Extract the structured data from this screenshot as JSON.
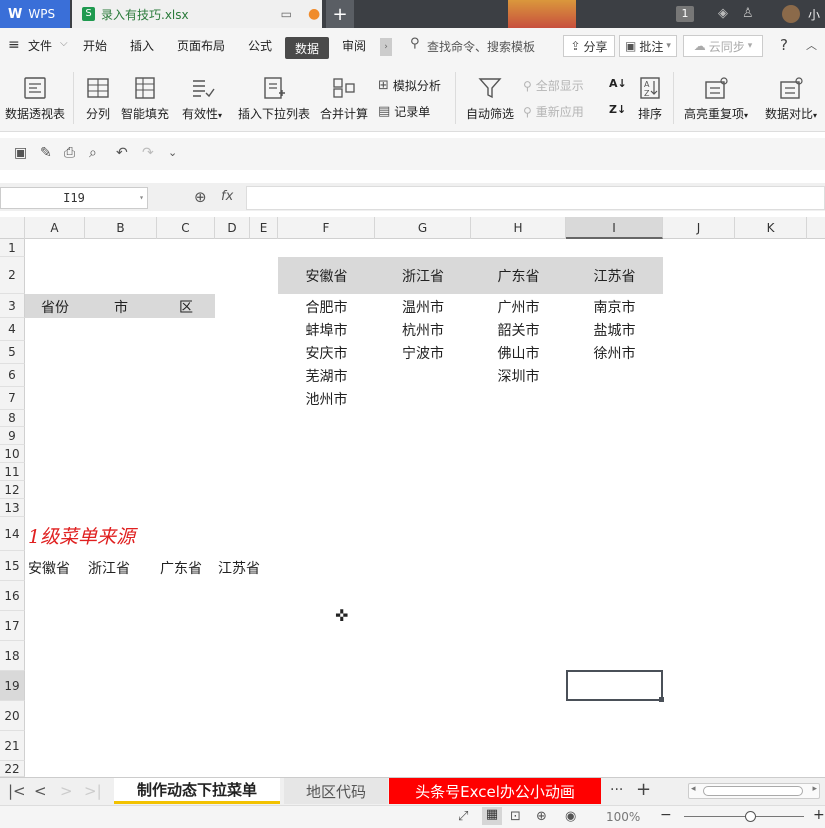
{
  "titlebar": {
    "app_tab": "WPS",
    "file_tab": "录入有技巧.xlsx",
    "new_tab": "+",
    "badge": "1",
    "user": "小"
  },
  "menu": {
    "file": "文件",
    "items": [
      "开始",
      "插入",
      "页面布局",
      "公式"
    ],
    "active": "数据",
    "review": "审阅",
    "search_placeholder": "查找命令、搜索模板",
    "share": "分享",
    "comment": "批注",
    "cloud": "云同步",
    "help": "?"
  },
  "ribbon": {
    "pivot": "数据透视表",
    "split": "分列",
    "smartfill": "智能填充",
    "validity": "有效性",
    "dropdown": "插入下拉列表",
    "merge": "合并计算",
    "simulate": "模拟分析",
    "record": "记录单",
    "autofilter": "自动筛选",
    "showall": "全部显示",
    "reapply": "重新应用",
    "sort": "排序",
    "highlight_dup": "高亮重复项",
    "compare": "数据对比"
  },
  "formula_bar": {
    "namebox": "I19",
    "fx": "fx"
  },
  "grid": {
    "columns": [
      "A",
      "B",
      "C",
      "D",
      "E",
      "F",
      "G",
      "H",
      "I",
      "J",
      "K"
    ],
    "rows": [
      "1",
      "2",
      "3",
      "4",
      "5",
      "6",
      "7",
      "8",
      "9",
      "10",
      "11",
      "12",
      "13",
      "14",
      "15",
      "16",
      "17",
      "18",
      "19",
      "20",
      "21",
      "22"
    ],
    "selected_cell": "I19",
    "header_row": [
      "省份",
      "市",
      "区"
    ],
    "provinces": [
      "安徽省",
      "浙江省",
      "广东省",
      "江苏省"
    ],
    "cities": [
      [
        "合肥市",
        "蚌埠市",
        "安庆市",
        "芜湖市",
        "池州市"
      ],
      [
        "温州市",
        "杭州市",
        "宁波市"
      ],
      [
        "广州市",
        "韶关市",
        "佛山市",
        "深圳市"
      ],
      [
        "南京市",
        "盐城市",
        "徐州市"
      ]
    ],
    "note": "1级菜单来源",
    "row15": [
      "安徽省",
      "浙江省",
      "广东省",
      "江苏省"
    ]
  },
  "sheets": {
    "active": "制作动态下拉菜单",
    "second": "地区代码",
    "third": "头条号Excel办公小动画",
    "more": "···",
    "add": "+"
  },
  "status": {
    "zoom": "100%"
  },
  "colors": {
    "accent": "#3a6fd8",
    "header_fill": "#d9d9d9",
    "note_red": "#e02020",
    "tab_red": "#ff0000",
    "tab_underline": "#f2c200"
  }
}
